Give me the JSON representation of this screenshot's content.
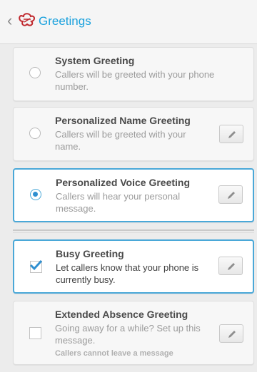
{
  "app_bar": {
    "title": "Greetings",
    "back_icon": "chevron-left-icon",
    "logo_icon": "app-logo-icon",
    "accent_color": "#1aa1dd"
  },
  "greetings": [
    {
      "title": "System Greeting",
      "description_lines": [
        "Callers will be greeted with your phone",
        "number."
      ],
      "control": "radio",
      "selected": false,
      "editable": false
    },
    {
      "title": "Personalized Name Greeting",
      "description_lines": [
        "Callers will be greeted with your",
        "name."
      ],
      "control": "radio",
      "selected": false,
      "editable": true
    },
    {
      "title": "Personalized Voice Greeting",
      "description_lines": [
        "Callers will hear your personal",
        "message."
      ],
      "control": "radio",
      "selected": true,
      "editable": true
    },
    {
      "title": "Busy Greeting",
      "description_lines": [
        "Let callers know that your phone is",
        "currently busy."
      ],
      "control": "checkbox",
      "checked": true,
      "editable": true
    },
    {
      "title": "Extended Absence Greeting",
      "description_lines": [
        "Going away for a while? Set up this",
        "message."
      ],
      "note": "Callers cannot leave a message",
      "control": "checkbox",
      "checked": false,
      "editable": true
    }
  ]
}
